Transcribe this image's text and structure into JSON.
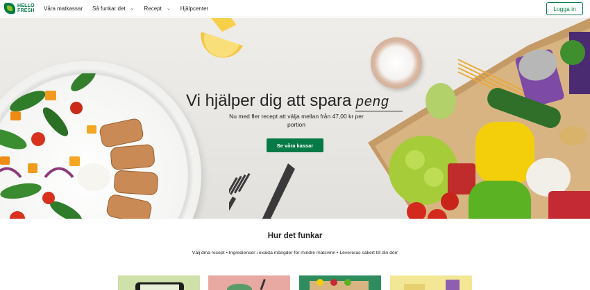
{
  "nav": {
    "logo_line1": "HELLO",
    "logo_line2": "FRESH",
    "items": [
      {
        "label": "Våra matkassar",
        "has_dropdown": false
      },
      {
        "label": "Så funkar det",
        "has_dropdown": true
      },
      {
        "label": "Recept",
        "has_dropdown": true
      },
      {
        "label": "Hjälpcenter",
        "has_dropdown": false
      }
    ],
    "login_label": "Logga in"
  },
  "hero": {
    "title": "Vi hjälper dig att spara",
    "typed_word": "peng",
    "subtitle": "Nu med fler recept att välja mellan från 47,00 kr per portion",
    "cta_label": "Se våra kassar"
  },
  "how": {
    "title": "Hur det funkar",
    "subtitle": "Välj dina recept • Ingredienser i exakta mängder för mindre matsvinn • Levereras säkert till din dörr"
  },
  "colors": {
    "brand_green": "#067a46",
    "logo_lime": "#91c11e",
    "hero_bg": "#efede9"
  }
}
